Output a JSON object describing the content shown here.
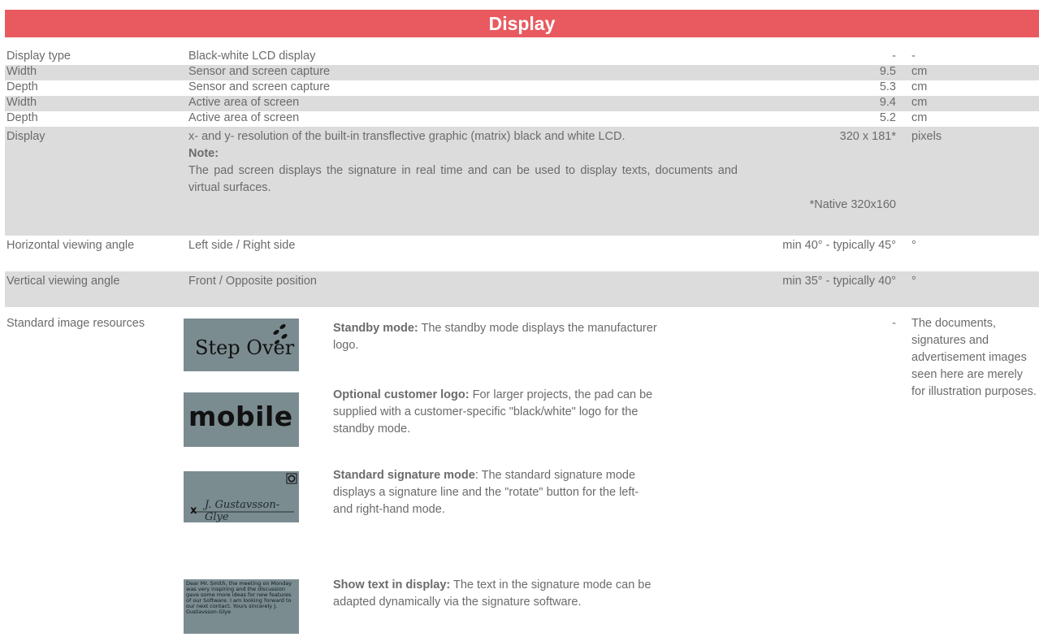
{
  "header": {
    "title": "Display"
  },
  "rows": [
    {
      "label": "Display type",
      "description": "Black-white LCD display",
      "value": "-",
      "unit": "-"
    },
    {
      "label": "Width",
      "description": "Sensor and screen capture",
      "value": "9.5",
      "unit": "cm"
    },
    {
      "label": "Depth",
      "description": "Sensor and screen capture",
      "value": "5.3",
      "unit": "cm"
    },
    {
      "label": "Width",
      "description": "Active area of screen",
      "value": "9.4",
      "unit": "cm"
    },
    {
      "label": "Depth",
      "description": "Active area of screen",
      "value": "5.2",
      "unit": "cm"
    }
  ],
  "display_row": {
    "label": "Display",
    "description": "x- and y- resolution of the built-in transflective graphic (matrix) black and white LCD.",
    "note_label": "Note:",
    "note_text": "The pad screen displays the signature in real time and can be used to display texts, documents and virtual surfaces.",
    "value": "320 x 181*",
    "value_note": "*Native 320x160",
    "unit": "pixels"
  },
  "angle_rows": [
    {
      "label": "Horizontal viewing angle",
      "description": "Left side / Right side",
      "value": "min 40° - typically 45°",
      "unit": "°"
    },
    {
      "label": "Vertical viewing angle",
      "description": "Front / Opposite position",
      "value": "min 35° - typically 40°",
      "unit": "°"
    }
  ],
  "image_resources": {
    "label": "Standard image resources",
    "value": "-",
    "remark": "The documents, signatures and advertisement images seen here are merely for illustration purposes.",
    "items": [
      {
        "title": "Standby mode:",
        "text": " The standby mode displays the manufacturer logo.",
        "thumb_text": "Step Over"
      },
      {
        "title": "Optional customer logo:",
        "text": " For larger projects, the pad can be supplied with a customer-specific \"black/white\" logo for the standby mode.",
        "thumb_text": "mobile"
      },
      {
        "title": "Standard signature mode",
        "text": ": The standard signature mode displays a signature line and the \"rotate\" button for the left- and right-hand mode.",
        "thumb_text": "J. Gustavsson-Glye"
      },
      {
        "title": "Show text in display:",
        "text": " The text in the signature mode can be adapted dynamically via the signature software.",
        "thumb_text": "Dear Mr. Smith, the meeting on Monday was very inspiring and the discussion gave some more ideas for new features of our Software. I am looking forward to our next contact. Yours sincerely J. Gustavsson-Glye"
      }
    ]
  }
}
